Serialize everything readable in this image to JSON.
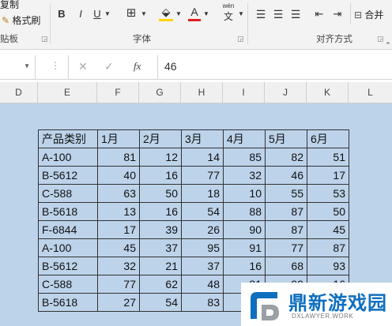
{
  "ribbon": {
    "copy_label": "复制",
    "format_painter_label": "格式刷",
    "clipboard_group": "贴板",
    "font_group": "字体",
    "align_group": "对齐方式",
    "merge_label": "合并",
    "bold": "B",
    "italic": "I",
    "underline": "U",
    "font_color_glyph": "A",
    "phonetic_top": "wén",
    "phonetic_bottom": "文"
  },
  "formula_bar": {
    "value": "46",
    "fx": "fx",
    "cancel": "✕",
    "enter": "✓"
  },
  "columns": [
    "D",
    "E",
    "F",
    "G",
    "H",
    "I",
    "J",
    "K",
    "L"
  ],
  "table": {
    "headers": [
      "产品类别",
      "1月",
      "2月",
      "3月",
      "4月",
      "5月",
      "6月"
    ],
    "rows": [
      [
        "A-100",
        "81",
        "12",
        "14",
        "85",
        "82",
        "51"
      ],
      [
        "B-5612",
        "40",
        "16",
        "77",
        "32",
        "46",
        "17"
      ],
      [
        "C-588",
        "63",
        "50",
        "18",
        "10",
        "55",
        "53"
      ],
      [
        "B-5618",
        "13",
        "16",
        "54",
        "88",
        "87",
        "50"
      ],
      [
        "F-6844",
        "17",
        "39",
        "26",
        "90",
        "87",
        "45"
      ],
      [
        "A-100",
        "45",
        "37",
        "95",
        "91",
        "77",
        "87"
      ],
      [
        "B-5612",
        "32",
        "21",
        "37",
        "16",
        "68",
        "93"
      ],
      [
        "C-588",
        "77",
        "62",
        "48",
        "81",
        "99",
        "16"
      ],
      [
        "B-5618",
        "27",
        "54",
        "83",
        "",
        "",
        ""
      ]
    ]
  },
  "watermark": {
    "title": "鼎新游戏园",
    "subtitle": "DXLAWYER.WORK",
    "color": "#0e6fbf"
  },
  "colors": {
    "sheet_bg": "#bcd3ea",
    "font_color_bar": "#e02020",
    "fill_color_bar": "#ffd400"
  }
}
